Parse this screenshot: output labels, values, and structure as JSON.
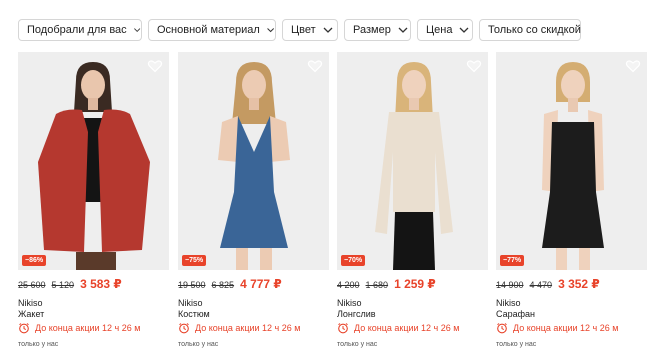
{
  "filters": [
    {
      "label": "Подобрали для вас"
    },
    {
      "label": "Основной материал"
    },
    {
      "label": "Цвет"
    },
    {
      "label": "Размер"
    },
    {
      "label": "Цена"
    },
    {
      "label": "Только со скидкой"
    }
  ],
  "colors": {
    "accent": "#e8432a",
    "photo_bg": "#eeeeee",
    "chip_border": "#d6d6d6"
  },
  "products": [
    {
      "discount": "−86%",
      "old_prices": [
        "25 600",
        "5 120"
      ],
      "price": "3 583 ₽",
      "brand": "Nikiso",
      "type": "Жакет",
      "promo": "До конца акции 12 ч 26 м",
      "note": "только у нас",
      "garment_color": "#b5382f"
    },
    {
      "discount": "−75%",
      "old_prices": [
        "19 500",
        "6 825"
      ],
      "price": "4 777 ₽",
      "brand": "Nikiso",
      "type": "Костюм",
      "promo": "До конца акции 12 ч 26 м",
      "note": "только у нас",
      "garment_color": "#3a6597"
    },
    {
      "discount": "−70%",
      "old_prices": [
        "4 200",
        "1 680"
      ],
      "price": "1 259 ₽",
      "brand": "Nikiso",
      "type": "Лонгслив",
      "promo": "До конца акции 12 ч 26 м",
      "note": "только у нас",
      "garment_color": "#eadfd0"
    },
    {
      "discount": "−77%",
      "old_prices": [
        "14 900",
        "4 470"
      ],
      "price": "3 352 ₽",
      "brand": "Nikiso",
      "type": "Сарафан",
      "promo": "До конца акции 12 ч 26 м",
      "note": "только у нас",
      "garment_color": "#1c1c1c"
    }
  ]
}
